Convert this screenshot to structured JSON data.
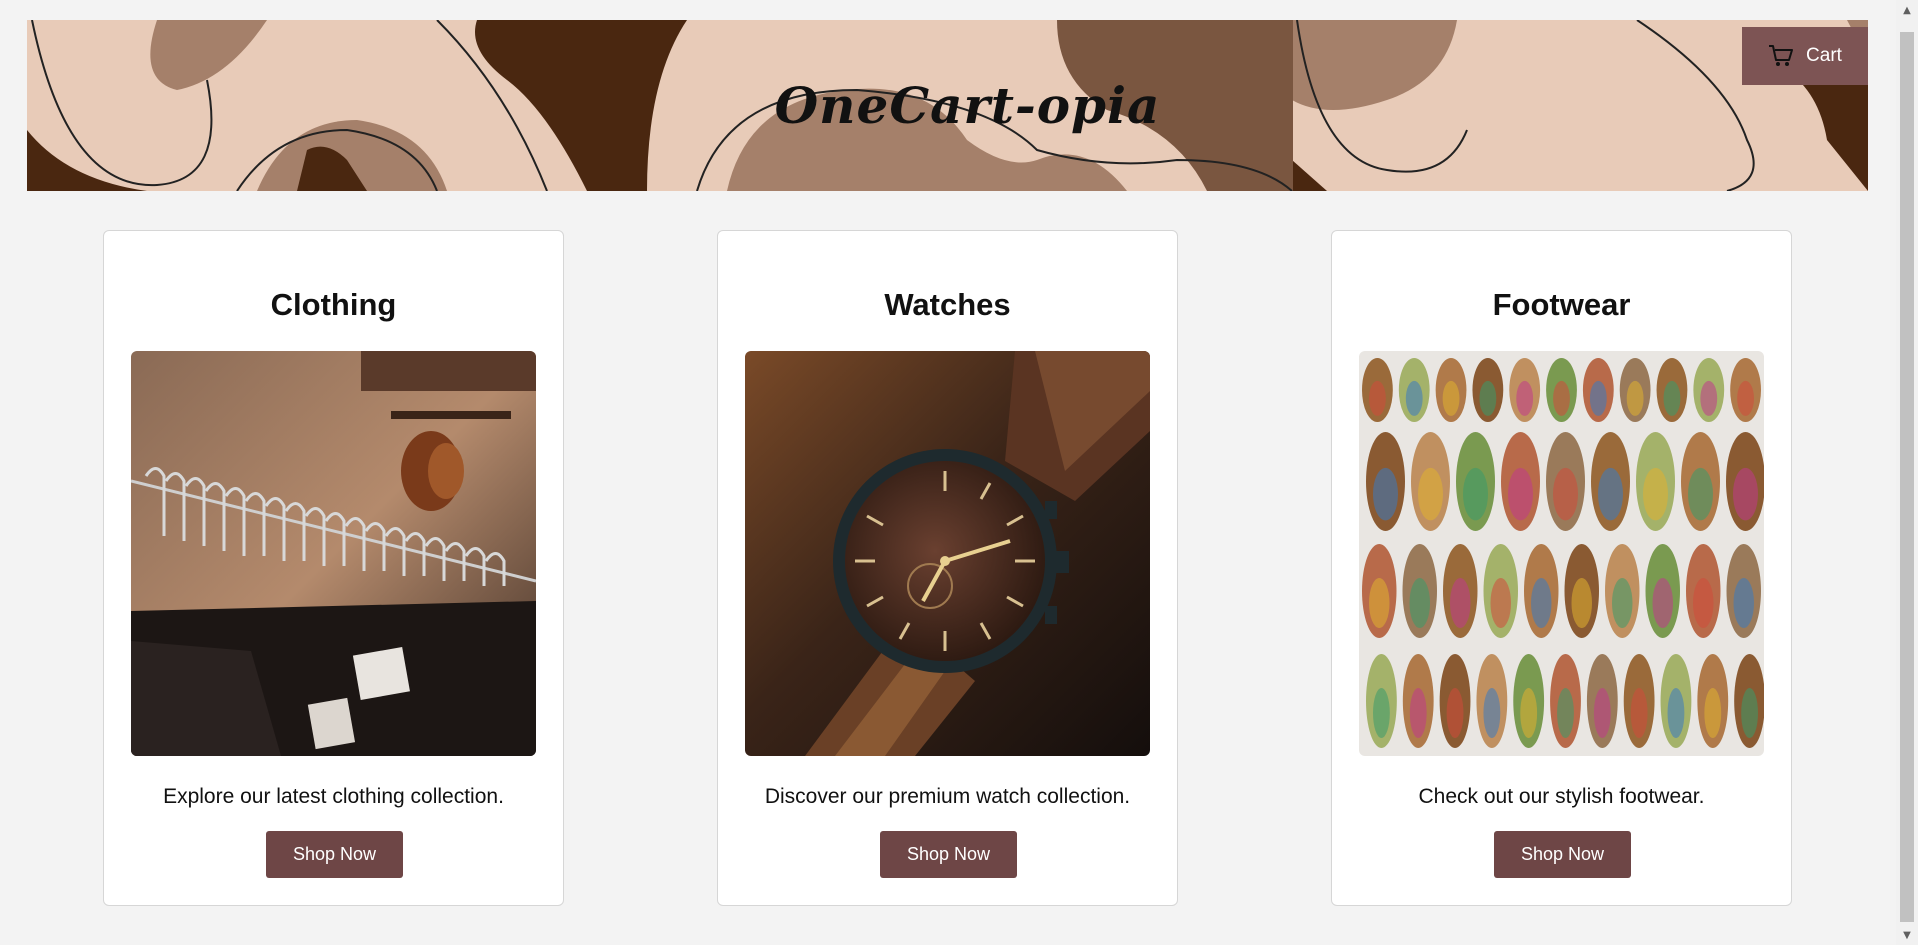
{
  "header": {
    "brand": "OneCart-opia",
    "cart_label": "Cart"
  },
  "categories": [
    {
      "title": "Clothing",
      "description": "Explore our latest clothing collection.",
      "button": "Shop Now"
    },
    {
      "title": "Watches",
      "description": "Discover our premium watch collection.",
      "button": "Shop Now"
    },
    {
      "title": "Footwear",
      "description": "Check out our stylish footwear.",
      "button": "Shop Now"
    }
  ],
  "colors": {
    "page_bg": "#f3f3f3",
    "banner_light": "#e8cbb8",
    "banner_mid": "#a5806a",
    "banner_dark": "#4a2710",
    "button": "#6e4646",
    "cart_button": "#7d5454"
  }
}
